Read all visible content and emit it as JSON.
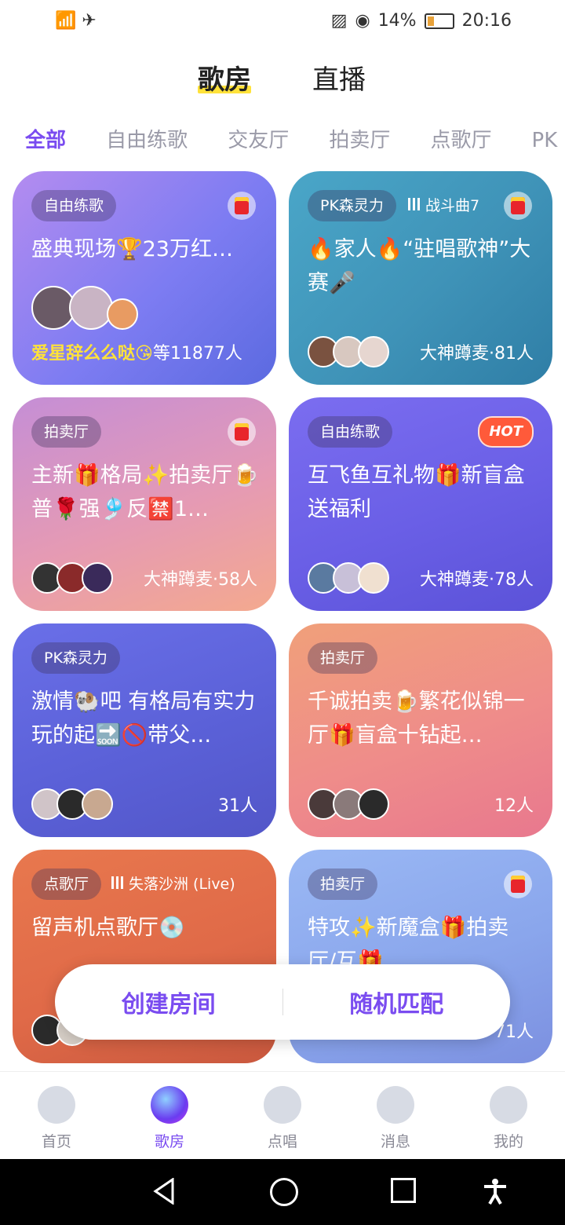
{
  "status_bar": {
    "battery": "14%",
    "time": "20:16"
  },
  "top_tabs": [
    {
      "label": "歌房",
      "active": true
    },
    {
      "label": "直播",
      "active": false
    }
  ],
  "category_tabs": [
    {
      "label": "全部",
      "active": true
    },
    {
      "label": "自由练歌"
    },
    {
      "label": "交友厅"
    },
    {
      "label": "拍卖厅"
    },
    {
      "label": "点歌厅"
    },
    {
      "label": "PK"
    }
  ],
  "rooms": [
    {
      "tag": "自由练歌",
      "title": "盛典现场🏆23万红…",
      "host_name": "爱星辞么么哒😘",
      "count": "等11877人",
      "badge": "redpack",
      "bg": "linear-gradient(135deg,#b48cf0,#7d7cf2 55%,#5b6ae0)"
    },
    {
      "tag": "PK森灵力",
      "song": "战斗曲7",
      "title": "🔥家人🔥“驻唱歌神”大赛🎤",
      "count": "大神蹲麦·81人",
      "badge": "redpack",
      "bg": "linear-gradient(135deg,#4aa6c8,#3f93b8 55%,#2f7ea6)"
    },
    {
      "tag": "拍卖厅",
      "title": "主新🎁格局✨拍卖厅🍺普🌹强🎐反🈲1…",
      "count": "大神蹲麦·58人",
      "bg": "linear-gradient(160deg,#c58ed6,#e59ab4 55%,#f4a98e)"
    },
    {
      "tag": "自由练歌",
      "title": "互飞鱼互礼物🎁新盲盒送福利",
      "count": "大神蹲麦·78人",
      "badge": "HOT",
      "bg": "linear-gradient(160deg,#7b6df0,#6a5fe6 55%,#5b52d8)"
    },
    {
      "tag": "PK森灵力",
      "title": "激情🐏吧 有格局有实力玩的起🔜🚫带父…",
      "count": "31人",
      "bg": "linear-gradient(160deg,#6a6fe8,#5b61d8 55%,#5256c8)"
    },
    {
      "tag": "拍卖厅",
      "title": "千诚拍卖🍺繁花似锦一厅🎁盲盒十钻起…",
      "count": "12人",
      "bg": "linear-gradient(160deg,#f0a07a,#ef8c8a 55%,#e8788e)"
    },
    {
      "tag": "点歌厅",
      "song": "失落沙洲 (Live)",
      "title": "留声机点歌厅💿",
      "count": "",
      "bg": "linear-gradient(160deg,#e8784e,#e06a48 55%,#c9583e)"
    },
    {
      "tag": "拍卖厅",
      "title": "特攻✨新魔盒🎁拍卖厅/互🎁",
      "count": "71人",
      "badge": "redpack",
      "bg": "linear-gradient(160deg,#9ab8f4,#8aa6ec 55%,#7c90e0)"
    }
  ],
  "float_bar": {
    "create": "创建房间",
    "match": "随机匹配"
  },
  "bottom_nav": [
    {
      "label": "首页",
      "icon": "home-icon"
    },
    {
      "label": "歌房",
      "icon": "karaoke-room-icon",
      "active": true
    },
    {
      "label": "点唱",
      "icon": "sing-icon"
    },
    {
      "label": "消息",
      "icon": "message-icon"
    },
    {
      "label": "我的",
      "icon": "profile-icon"
    }
  ]
}
